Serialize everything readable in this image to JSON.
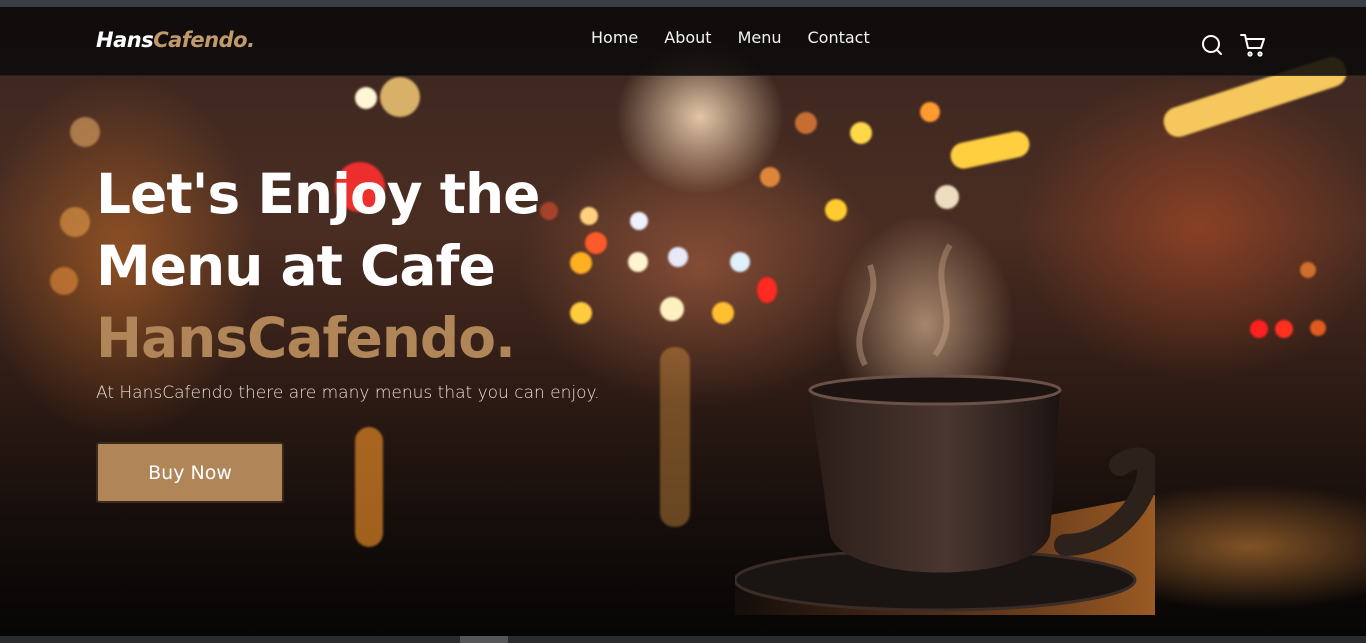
{
  "navbar": {
    "logo_main": "Hans",
    "logo_accent": "Cafendo.",
    "links": [
      "Home",
      "About",
      "Menu",
      "Contact"
    ],
    "icons": [
      "search-icon",
      "cart-icon"
    ]
  },
  "hero": {
    "headline_line1": "Let's Enjoy the",
    "headline_line2": "Menu at Cafe",
    "headline_brand": "HansCafendo.",
    "subtitle": "At HansCafendo there are many menus that you can enjoy.",
    "cta_label": "Buy Now"
  },
  "colors": {
    "accent": "#b08558",
    "navbar_bg": "#0c0a0a",
    "text": "#ffffff"
  }
}
